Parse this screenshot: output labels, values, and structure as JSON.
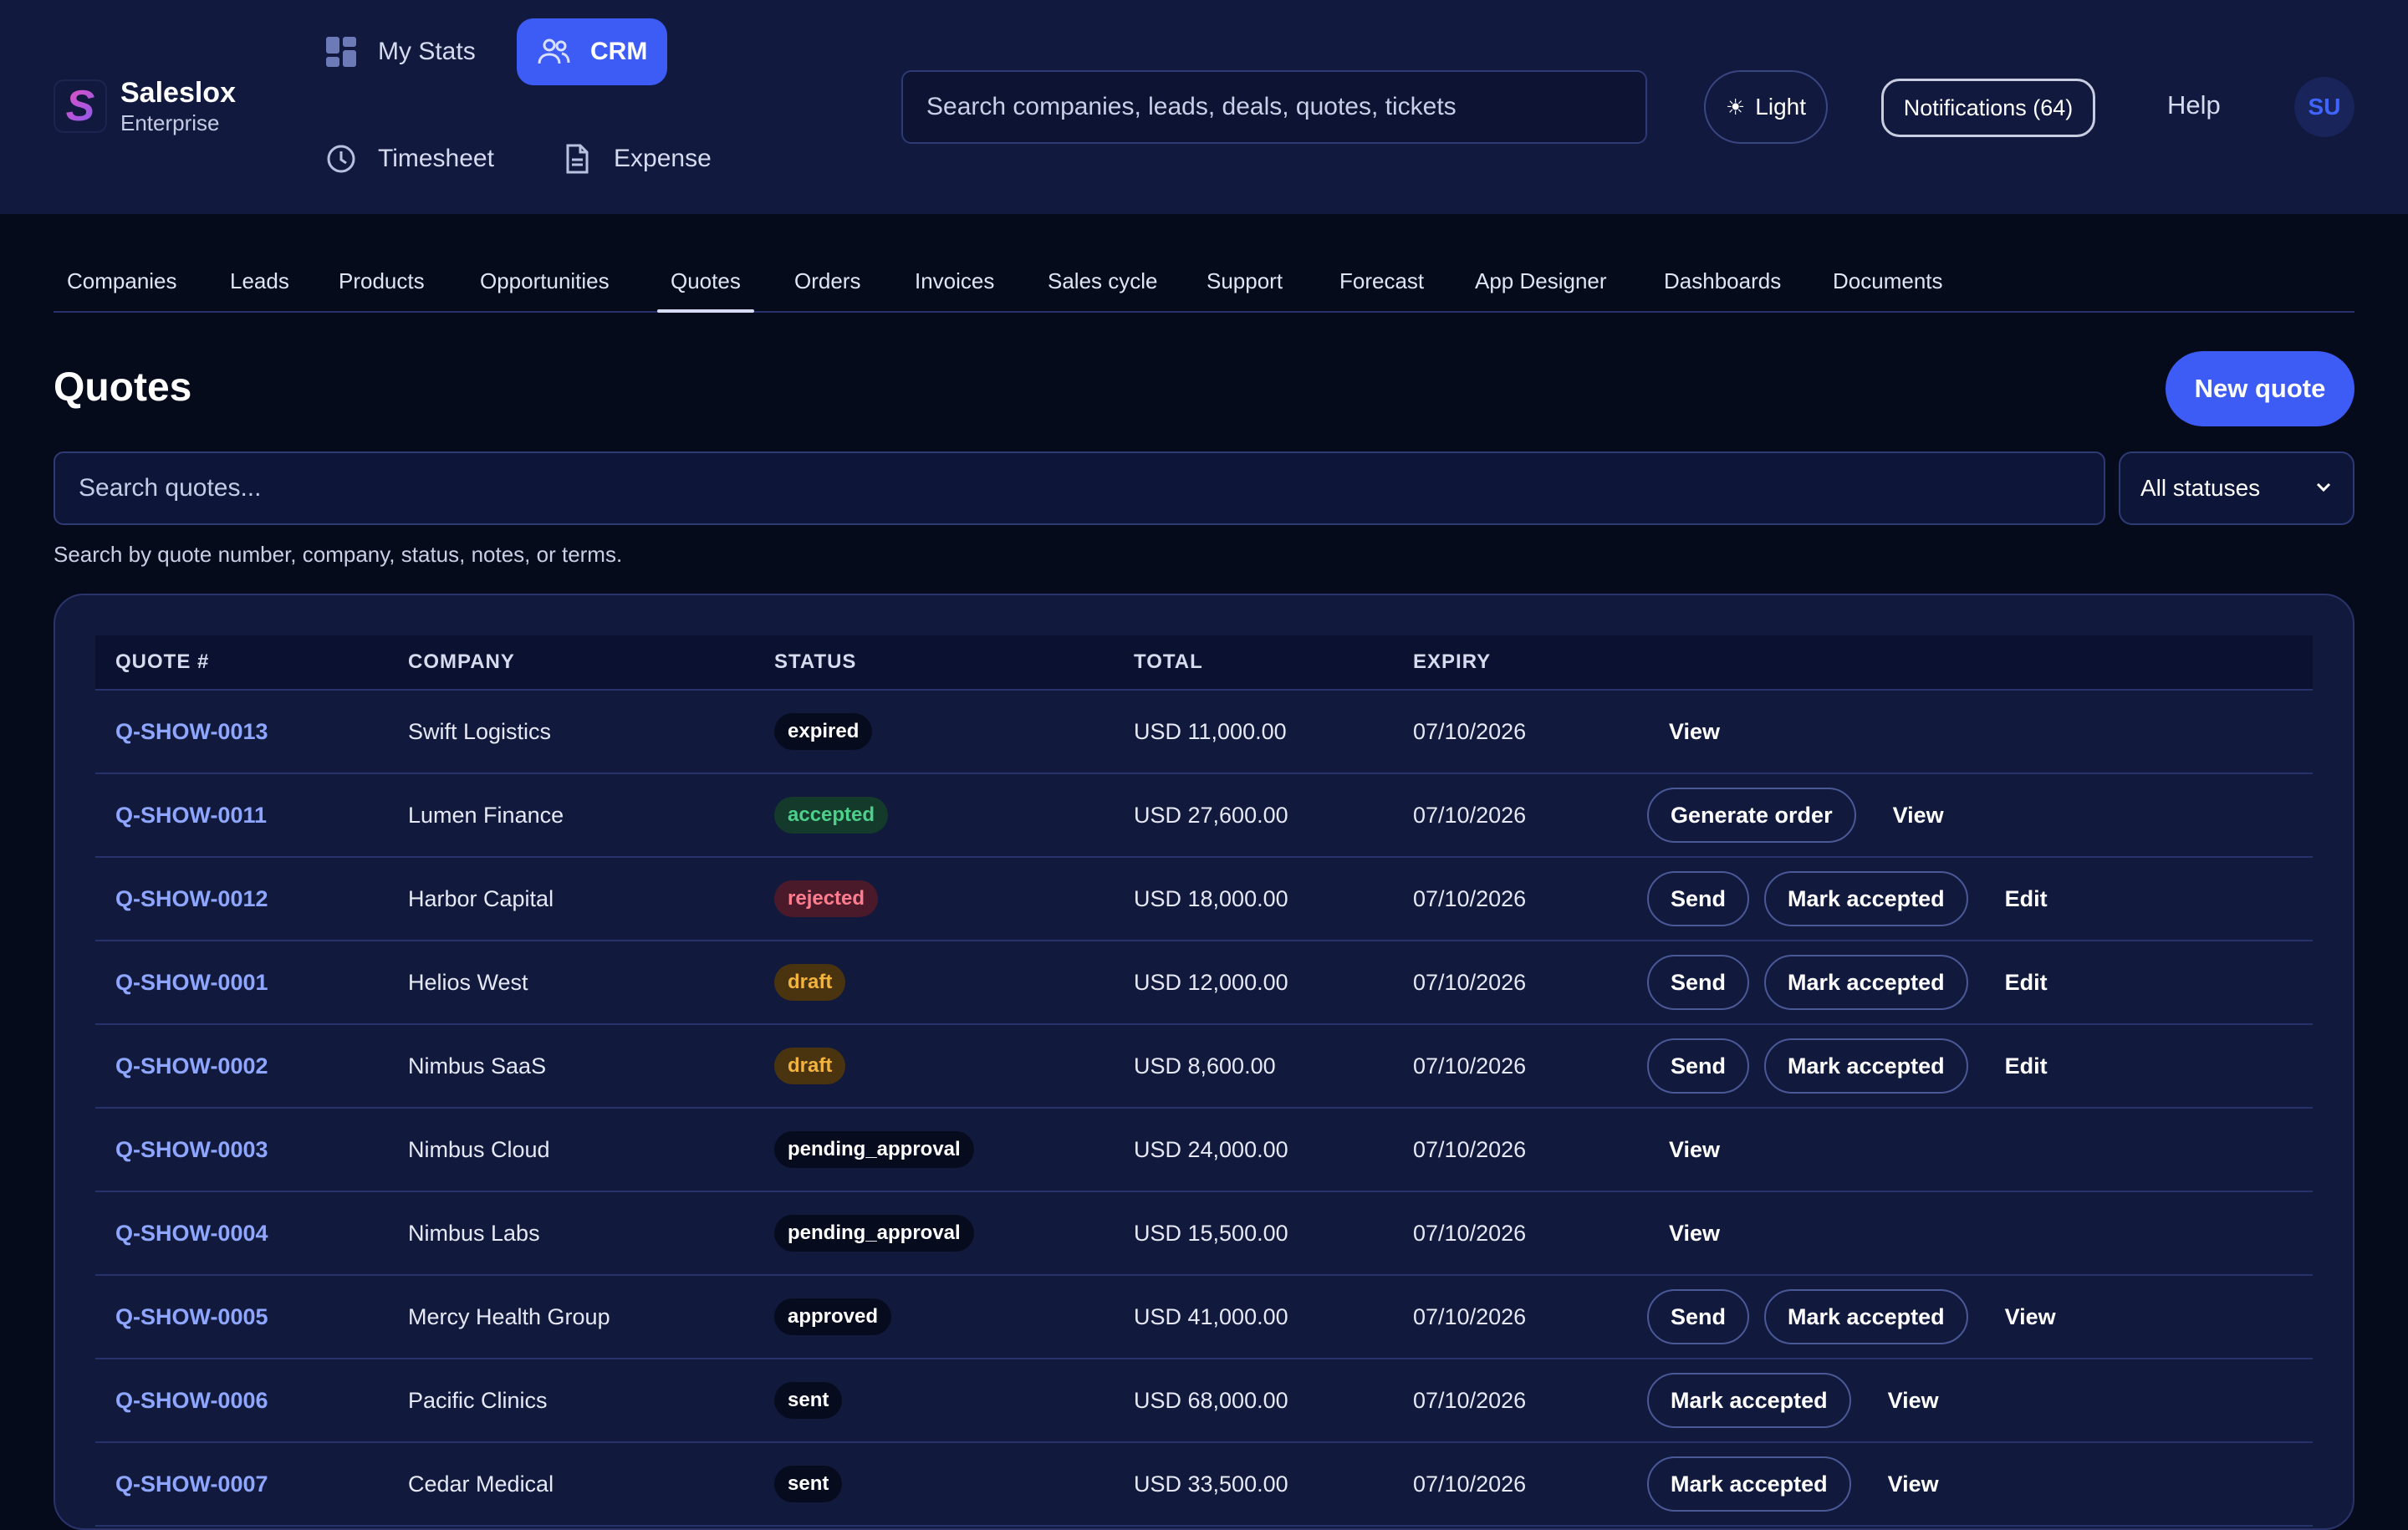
{
  "brand": {
    "name": "Saleslox",
    "edition": "Enterprise",
    "logo_letter": "S"
  },
  "app_nav": [
    {
      "label": "My Stats",
      "icon": "dashboard-icon",
      "active": false
    },
    {
      "label": "CRM",
      "icon": "users-icon",
      "active": true
    },
    {
      "label": "Timesheet",
      "icon": "clock-icon",
      "active": false
    },
    {
      "label": "Expense",
      "icon": "document-icon",
      "active": false
    }
  ],
  "global_search": {
    "placeholder": "Search companies, leads, deals, quotes, tickets"
  },
  "header": {
    "theme_toggle": "Light",
    "notifications": "Notifications (64)",
    "help": "Help",
    "avatar_initials": "SU"
  },
  "module_tabs": [
    "Companies",
    "Leads",
    "Products",
    "Opportunities",
    "Quotes",
    "Orders",
    "Invoices",
    "Sales cycle",
    "Support",
    "Forecast",
    "App Designer",
    "Dashboards",
    "Documents"
  ],
  "active_tab": "Quotes",
  "page": {
    "title": "Quotes",
    "new_button": "New quote",
    "search_placeholder": "Search quotes...",
    "status_filter": "All statuses",
    "hint": "Search by quote number, company, status, notes, or terms."
  },
  "table": {
    "columns": [
      "QUOTE #",
      "COMPANY",
      "STATUS",
      "TOTAL",
      "EXPIRY"
    ],
    "rows": [
      {
        "quote": "Q-SHOW-0013",
        "company": "Swift Logistics",
        "status": "expired",
        "total": "USD 11,000.00",
        "expiry": "07/10/2026",
        "actions": [
          {
            "label": "View",
            "style": "text"
          }
        ]
      },
      {
        "quote": "Q-SHOW-0011",
        "company": "Lumen Finance",
        "status": "accepted",
        "total": "USD 27,600.00",
        "expiry": "07/10/2026",
        "actions": [
          {
            "label": "Generate order",
            "style": "outline"
          },
          {
            "label": "View",
            "style": "text"
          }
        ]
      },
      {
        "quote": "Q-SHOW-0012",
        "company": "Harbor Capital",
        "status": "rejected",
        "total": "USD 18,000.00",
        "expiry": "07/10/2026",
        "actions": [
          {
            "label": "Send",
            "style": "outline"
          },
          {
            "label": "Mark accepted",
            "style": "outline"
          },
          {
            "label": "Edit",
            "style": "text"
          }
        ]
      },
      {
        "quote": "Q-SHOW-0001",
        "company": "Helios West",
        "status": "draft",
        "total": "USD 12,000.00",
        "expiry": "07/10/2026",
        "actions": [
          {
            "label": "Send",
            "style": "outline"
          },
          {
            "label": "Mark accepted",
            "style": "outline"
          },
          {
            "label": "Edit",
            "style": "text"
          }
        ]
      },
      {
        "quote": "Q-SHOW-0002",
        "company": "Nimbus SaaS",
        "status": "draft",
        "total": "USD 8,600.00",
        "expiry": "07/10/2026",
        "actions": [
          {
            "label": "Send",
            "style": "outline"
          },
          {
            "label": "Mark accepted",
            "style": "outline"
          },
          {
            "label": "Edit",
            "style": "text"
          }
        ]
      },
      {
        "quote": "Q-SHOW-0003",
        "company": "Nimbus Cloud",
        "status": "pending_approval",
        "total": "USD 24,000.00",
        "expiry": "07/10/2026",
        "actions": [
          {
            "label": "View",
            "style": "text"
          }
        ]
      },
      {
        "quote": "Q-SHOW-0004",
        "company": "Nimbus Labs",
        "status": "pending_approval",
        "total": "USD 15,500.00",
        "expiry": "07/10/2026",
        "actions": [
          {
            "label": "View",
            "style": "text"
          }
        ]
      },
      {
        "quote": "Q-SHOW-0005",
        "company": "Mercy Health Group",
        "status": "approved",
        "total": "USD 41,000.00",
        "expiry": "07/10/2026",
        "actions": [
          {
            "label": "Send",
            "style": "outline"
          },
          {
            "label": "Mark accepted",
            "style": "outline"
          },
          {
            "label": "View",
            "style": "text"
          }
        ]
      },
      {
        "quote": "Q-SHOW-0006",
        "company": "Pacific Clinics",
        "status": "sent",
        "total": "USD 68,000.00",
        "expiry": "07/10/2026",
        "actions": [
          {
            "label": "Mark accepted",
            "style": "outline"
          },
          {
            "label": "View",
            "style": "text"
          }
        ]
      },
      {
        "quote": "Q-SHOW-0007",
        "company": "Cedar Medical",
        "status": "sent",
        "total": "USD 33,500.00",
        "expiry": "07/10/2026",
        "actions": [
          {
            "label": "Mark accepted",
            "style": "outline"
          },
          {
            "label": "View",
            "style": "text"
          }
        ]
      }
    ]
  },
  "colors": {
    "header_bg": "#111a3e",
    "page_bg": "#060b1c",
    "accent": "#3d5cf5",
    "link": "#8ea6ff"
  }
}
